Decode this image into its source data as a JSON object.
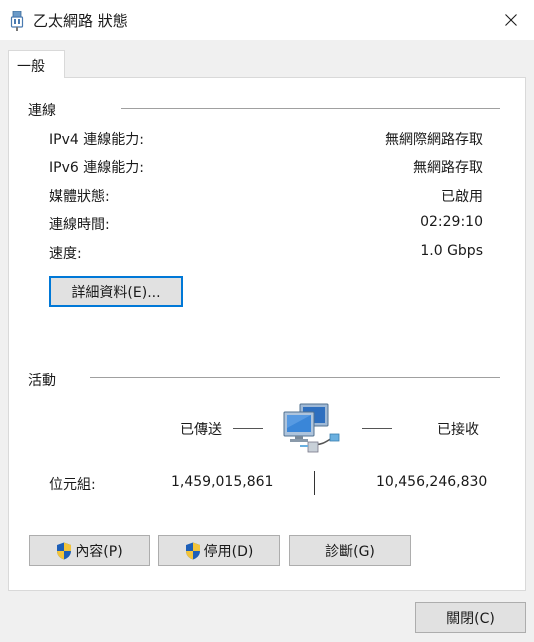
{
  "window": {
    "title": "乙太網路 狀態",
    "icon": "network-adapter-icon",
    "close_icon": "close-icon"
  },
  "tabs": [
    {
      "label": "一般",
      "active": true
    }
  ],
  "connection": {
    "section_label": "連線",
    "rows": [
      {
        "label": "IPv4 連線能力:",
        "value": "無網際網路存取"
      },
      {
        "label": "IPv6 連線能力:",
        "value": "無網路存取"
      },
      {
        "label": "媒體狀態:",
        "value": "已啟用"
      },
      {
        "label": "連線時間:",
        "value": "02:29:10"
      },
      {
        "label": "速度:",
        "value": "1.0 Gbps"
      }
    ],
    "details_button": "詳細資料(E)..."
  },
  "activity": {
    "section_label": "活動",
    "sent_label": "已傳送",
    "received_label": "已接收",
    "bytes_label": "位元組:",
    "bytes_sent": "1,459,015,861",
    "bytes_received": "10,456,246,830",
    "icon": "network-computers-icon"
  },
  "buttons": {
    "properties": "內容(P)",
    "disable": "停用(D)",
    "diagnose": "診斷(G)",
    "close": "關閉(C)",
    "shield_icon": "uac-shield-icon"
  },
  "colors": {
    "focus_border": "#0078d7",
    "button_bg": "#e1e1e1",
    "panel_bg": "#ffffff",
    "window_bg": "#f0f0f0"
  }
}
